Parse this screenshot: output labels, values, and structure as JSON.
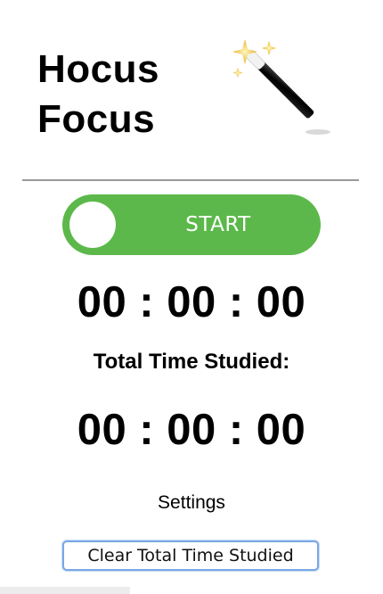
{
  "header": {
    "title_line1": "Hocus",
    "title_line2": "Focus"
  },
  "icons": {
    "wand": "magic-wand-sparkles-icon"
  },
  "toggle": {
    "label": "START",
    "state": "off",
    "color": "#5cb84a"
  },
  "timers": {
    "session": "00 : 00 : 00",
    "total_heading": "Total Time Studied:",
    "total": "00 : 00 : 00"
  },
  "settings_label": "Settings",
  "clear_button_label": "Clear Total Time Studied"
}
